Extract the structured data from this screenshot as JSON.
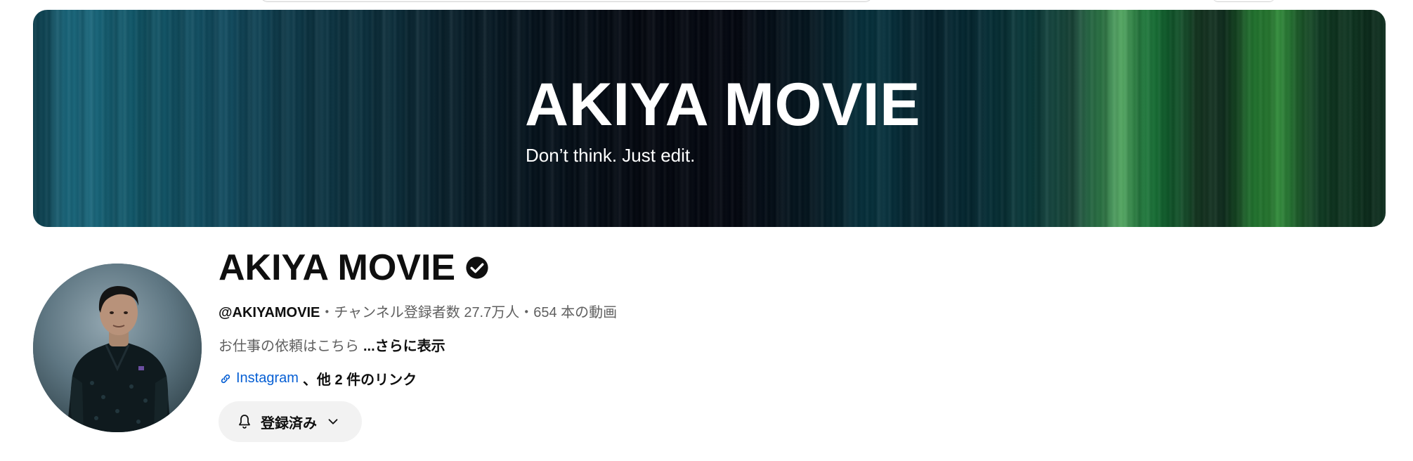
{
  "banner": {
    "title": "AKIYA MOVIE",
    "tagline": "Don’t think. Just edit."
  },
  "channel": {
    "name": "AKIYA MOVIE",
    "verified_icon": "verified-check-icon",
    "handle": "@AKIYAMOVIE",
    "separator": "・",
    "subscribers": "チャンネル登録者数 27.7万人",
    "videos": "654 本の動画",
    "description": "お仕事の依頼はこちら",
    "more_label": "...さらに表示",
    "link_icon": "link-icon",
    "primary_link": "Instagram",
    "other_links": "、他 2 件のリンク"
  },
  "subscribe_button": {
    "label": "登録済み",
    "icon": "bell-icon",
    "dropdown_icon": "chevron-down-icon"
  },
  "colors": {
    "link_blue": "#065fd4",
    "text_primary": "#0f0f0f",
    "text_secondary": "#606060",
    "button_bg": "#f2f2f2"
  }
}
